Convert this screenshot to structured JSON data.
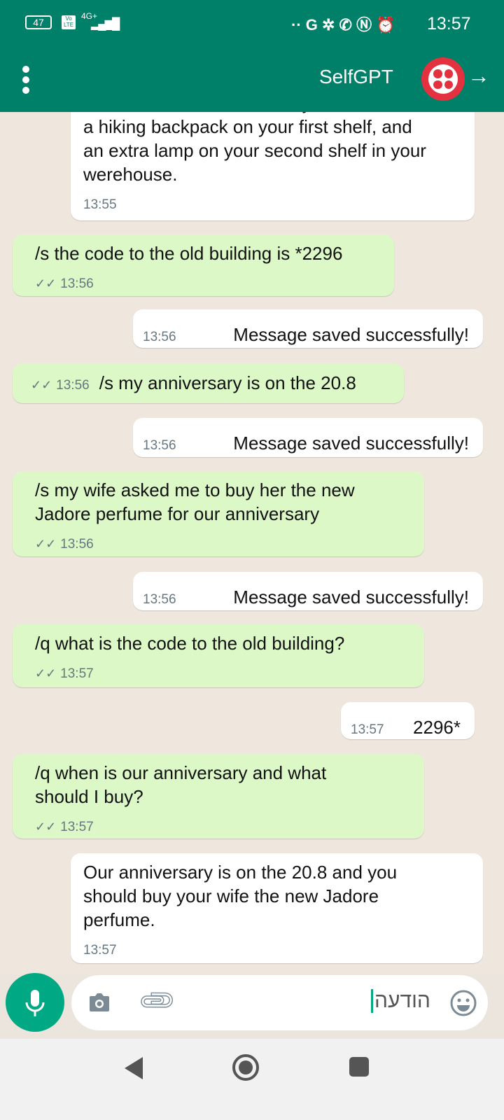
{
  "status_bar": {
    "battery": "47",
    "network": "4G+",
    "volte": "Vo LTE",
    "time": "13:57"
  },
  "header": {
    "title": "SelfGPT",
    "menu_icon": "more-vert-icon",
    "back_icon": "arrow-right-icon",
    "avatar_color": "#e3313f"
  },
  "colors": {
    "header": "#008069",
    "sent_bubble": "#dcf8c6",
    "received_bubble": "#ffffff",
    "chat_bg": "#efe7de",
    "accent": "#00a884"
  },
  "messages": [
    {
      "dir": "in",
      "lines": [
        "You have a screwdriver on your third shelf,",
        "a hiking backpack on your first shelf, and",
        "an extra lamp on your second shelf in your",
        "werehouse."
      ],
      "time": "13:55"
    },
    {
      "dir": "out",
      "lines": [
        "/s the code to the old building is *2296"
      ],
      "time": "13:56"
    },
    {
      "dir": "in",
      "lines": [
        "Message saved successfully!"
      ],
      "time": "13:56"
    },
    {
      "dir": "out",
      "lines": [
        "/s my anniversary is on the 20.8"
      ],
      "time": "13:56"
    },
    {
      "dir": "in",
      "lines": [
        "Message saved successfully!"
      ],
      "time": "13:56"
    },
    {
      "dir": "out",
      "lines": [
        "/s my wife asked me to buy her the new",
        "Jadore perfume for our anniversary"
      ],
      "time": "13:56"
    },
    {
      "dir": "in",
      "lines": [
        "Message saved successfully!"
      ],
      "time": "13:56"
    },
    {
      "dir": "out",
      "lines": [
        "/q what is the code to the old building?"
      ],
      "time": "13:57"
    },
    {
      "dir": "in",
      "lines": [
        "2296*"
      ],
      "time": "13:57"
    },
    {
      "dir": "out",
      "lines": [
        "/q when is our anniversary and what",
        "should I buy?"
      ],
      "time": "13:57"
    },
    {
      "dir": "in",
      "lines": [
        "Our anniversary is on the 20.8 and you",
        "should buy your wife the new Jadore",
        "perfume."
      ],
      "time": "13:57"
    }
  ],
  "composer": {
    "placeholder": "הודעה"
  }
}
